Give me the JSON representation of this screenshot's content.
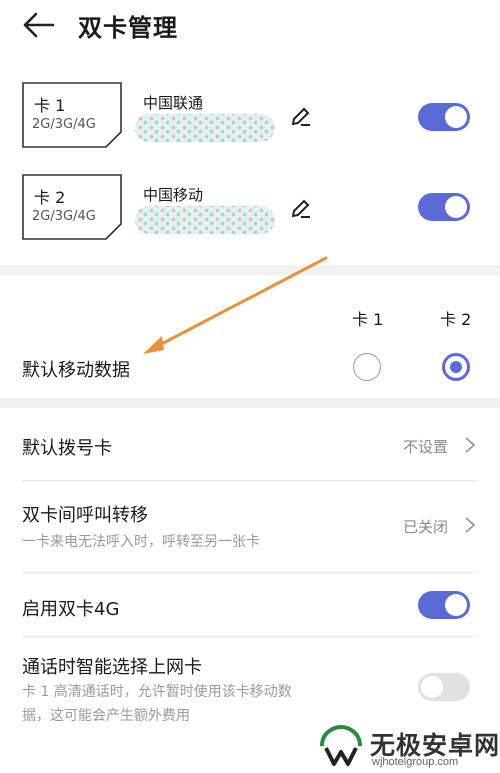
{
  "header": {
    "title": "双卡管理"
  },
  "sims": [
    {
      "name": "卡 1",
      "network": "2G/3G/4G",
      "carrier": "中国联通",
      "enabled": true
    },
    {
      "name": "卡 2",
      "network": "2G/3G/4G",
      "carrier": "中国移动",
      "enabled": true
    }
  ],
  "default_data": {
    "label": "默认移动数据",
    "col1": "卡 1",
    "col2": "卡 2",
    "selected": "卡 2"
  },
  "default_dial": {
    "label": "默认拨号卡",
    "value": "不设置"
  },
  "call_forward": {
    "label": "双卡间呼叫转移",
    "desc": "一卡来电无法呼入时，呼转至另一张卡",
    "value": "已关闭"
  },
  "dual_4g": {
    "label": "启用双卡4G",
    "enabled": true
  },
  "smart_select": {
    "label": "通话时智能选择上网卡",
    "desc_line1": "卡 1 高清通话时，允许暂时使用该卡移动数",
    "desc_line2": "据，这可能会产生额外费用",
    "enabled": false
  },
  "watermark": {
    "main": "无极安卓网",
    "sub": "wjhotelgroup.com"
  },
  "colors": {
    "accent": "#5b6bd6",
    "arrow": "#e8923a"
  }
}
